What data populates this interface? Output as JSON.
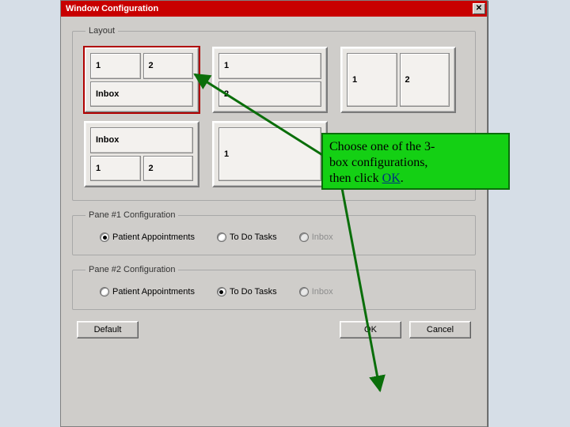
{
  "window": {
    "title": "Window Configuration",
    "close_symbol": "✕"
  },
  "group_labels": {
    "layout": "Layout",
    "pane1": "Pane #1 Configuration",
    "pane2": "Pane #2 Configuration"
  },
  "layout_options": {
    "opt0": {
      "cells": [
        "1",
        "2",
        "Inbox"
      ],
      "selected": true
    },
    "opt1": {
      "cells": [
        "1",
        "2"
      ]
    },
    "opt2": {
      "cells": [
        "1",
        "2"
      ]
    },
    "opt3": {
      "cells": [
        "Inbox",
        "1",
        "2"
      ]
    },
    "opt4": {
      "cells": [
        "1"
      ]
    }
  },
  "radio_options": {
    "patient": "Patient Appointments",
    "todo": "To Do Tasks",
    "inbox": "Inbox"
  },
  "pane1_selected": "patient",
  "pane2_selected": "todo",
  "buttons": {
    "default": "Default",
    "ok": "OK",
    "cancel": "Cancel"
  },
  "callout": {
    "line1": "Choose one of the 3-",
    "line2": "box configurations,",
    "line3_prefix": "then click ",
    "line3_ok": "OK",
    "line3_suffix": "."
  }
}
